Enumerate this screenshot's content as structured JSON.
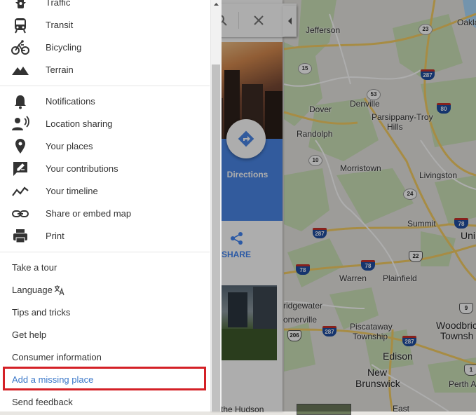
{
  "menu": {
    "layer_items": [
      {
        "label": "Traffic",
        "icon": "traffic-icon"
      },
      {
        "label": "Transit",
        "icon": "transit-icon"
      },
      {
        "label": "Bicycling",
        "icon": "bicycle-icon"
      },
      {
        "label": "Terrain",
        "icon": "terrain-icon"
      }
    ],
    "tool_items": [
      {
        "label": "Notifications",
        "icon": "bell-icon"
      },
      {
        "label": "Location sharing",
        "icon": "location-sharing-icon"
      },
      {
        "label": "Your places",
        "icon": "pin-icon"
      },
      {
        "label": "Your contributions",
        "icon": "edit-icon"
      },
      {
        "label": "Your timeline",
        "icon": "timeline-icon"
      },
      {
        "label": "Share or embed map",
        "icon": "link-icon"
      },
      {
        "label": "Print",
        "icon": "print-icon"
      }
    ],
    "text_items": [
      {
        "label": "Take a tour"
      },
      {
        "label": "Language"
      },
      {
        "label": "Tips and tricks"
      },
      {
        "label": "Get help"
      },
      {
        "label": "Consumer information"
      },
      {
        "label": "Add a missing place"
      },
      {
        "label": "Send feedback"
      }
    ],
    "highlight_color": "#d42026",
    "link_color": "#3b78c9"
  },
  "place_panel": {
    "directions_label": "Directions",
    "share_label": "SHARE",
    "footer_text": "the Hudson"
  },
  "map": {
    "places": [
      {
        "label": "Jefferson"
      },
      {
        "label": "Oakla"
      },
      {
        "label": "Dover"
      },
      {
        "label": "Denville"
      },
      {
        "label": "Parsippany-Troy"
      },
      {
        "label": "Hills"
      },
      {
        "label": "Randolph"
      },
      {
        "label": "Morristown"
      },
      {
        "label": "Livingston"
      },
      {
        "label": "Summit"
      },
      {
        "label": "Uni"
      },
      {
        "label": "Warren"
      },
      {
        "label": "Plainfield"
      },
      {
        "label": "ridgewater"
      },
      {
        "label": "omerville"
      },
      {
        "label": "Piscataway"
      },
      {
        "label": "Township"
      },
      {
        "label": "Woodbric"
      },
      {
        "label": "Townsh"
      },
      {
        "label": "Edison"
      },
      {
        "label": "New"
      },
      {
        "label": "Brunswick"
      },
      {
        "label": "Perth A"
      },
      {
        "label": "East"
      }
    ],
    "shields": [
      {
        "label": "23",
        "kind": "state"
      },
      {
        "label": "15",
        "kind": "state"
      },
      {
        "label": "287",
        "kind": "interstate"
      },
      {
        "label": "53",
        "kind": "state"
      },
      {
        "label": "80",
        "kind": "interstate"
      },
      {
        "label": "10",
        "kind": "state"
      },
      {
        "label": "24",
        "kind": "state"
      },
      {
        "label": "287",
        "kind": "interstate"
      },
      {
        "label": "78",
        "kind": "interstate"
      },
      {
        "label": "78",
        "kind": "interstate"
      },
      {
        "label": "78",
        "kind": "interstate"
      },
      {
        "label": "22",
        "kind": "us"
      },
      {
        "label": "206",
        "kind": "us"
      },
      {
        "label": "287",
        "kind": "interstate"
      },
      {
        "label": "287",
        "kind": "interstate"
      },
      {
        "label": "9",
        "kind": "us"
      },
      {
        "label": "1",
        "kind": "us"
      }
    ]
  }
}
